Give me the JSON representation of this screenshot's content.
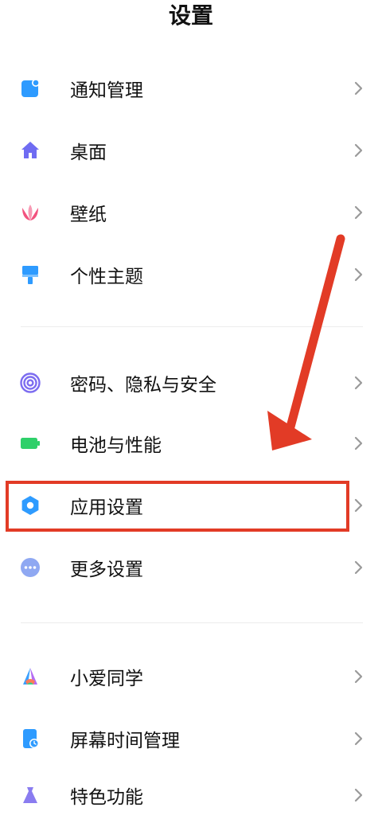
{
  "header": {
    "title": "设置"
  },
  "groups": [
    {
      "items": [
        {
          "label": "通知管理",
          "icon": "notification-icon",
          "color": "#2e9bff"
        },
        {
          "label": "桌面",
          "icon": "home-icon",
          "color": "#6f6cf2"
        },
        {
          "label": "壁纸",
          "icon": "tulip-icon",
          "color": "#f2527e"
        },
        {
          "label": "个性主题",
          "icon": "paint-brush-icon",
          "color": "#2e9bff"
        }
      ]
    },
    {
      "items": [
        {
          "label": "密码、隐私与安全",
          "icon": "fingerprint-icon",
          "color": "#7c6cf0"
        },
        {
          "label": "电池与性能",
          "icon": "battery-icon",
          "color": "#2fd06a"
        },
        {
          "label": "应用设置",
          "icon": "gear-icon",
          "color": "#2e9bff"
        },
        {
          "label": "更多设置",
          "icon": "more-dots-icon",
          "color": "#8fa8f2"
        }
      ]
    },
    {
      "items": [
        {
          "label": "小爱同学",
          "icon": "xiaoai-icon",
          "color": "#3aa0ff"
        },
        {
          "label": "屏幕时间管理",
          "icon": "screen-time-icon",
          "color": "#2e9bff"
        },
        {
          "label": "特色功能",
          "icon": "special-feature-icon",
          "color": "#8a7cf0"
        }
      ]
    }
  ],
  "annotation": {
    "color": "#e23b26",
    "highlighted_item": "应用设置"
  }
}
